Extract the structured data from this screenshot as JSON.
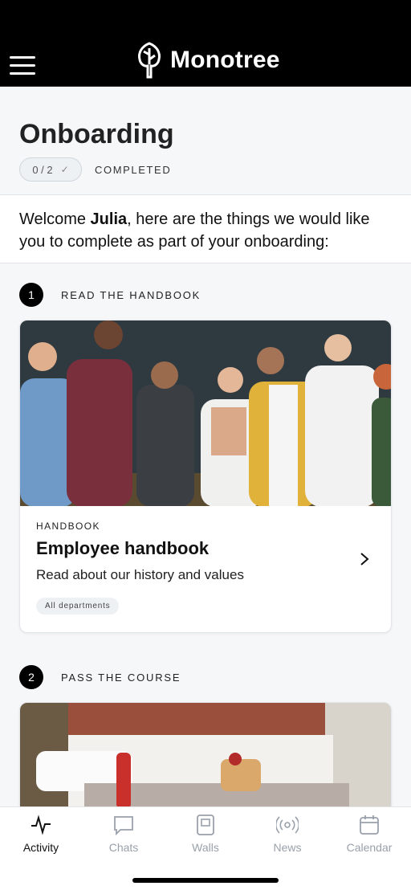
{
  "header": {
    "brand_name": "Monotree",
    "menu_icon": "hamburger-menu-icon",
    "logo_icon": "monotree-leaf-logo"
  },
  "onboarding": {
    "title": "Onboarding",
    "progress": "0 / 2",
    "progress_completed": 0,
    "progress_total": 2,
    "completed_label": "COMPLETED",
    "welcome_prefix": "Welcome ",
    "user_name": "Julia",
    "welcome_suffix": ", here are the things we would like you to complete as part of your onboarding:"
  },
  "steps": [
    {
      "number": "1",
      "label": "READ THE HANDBOOK",
      "card": {
        "kicker": "HANDBOOK",
        "title": "Employee handbook",
        "description": "Read about our history and values",
        "tag": "All departments",
        "image": "group-of-people-photo"
      }
    },
    {
      "number": "2",
      "label": "PASS THE COURSE",
      "card": {
        "image": "hotel-bed-photo"
      }
    }
  ],
  "bottom_nav": [
    {
      "label": "Activity",
      "icon": "activity-pulse-icon",
      "active": true
    },
    {
      "label": "Chats",
      "icon": "chat-bubble-icon",
      "active": false
    },
    {
      "label": "Walls",
      "icon": "wall-board-icon",
      "active": false
    },
    {
      "label": "News",
      "icon": "broadcast-icon",
      "active": false
    },
    {
      "label": "Calendar",
      "icon": "calendar-icon",
      "active": false
    }
  ],
  "colors": {
    "header_bg": "#000000",
    "page_bg": "#f6f7f9",
    "active_nav": "#111111",
    "inactive_nav": "#9aa1ab"
  }
}
